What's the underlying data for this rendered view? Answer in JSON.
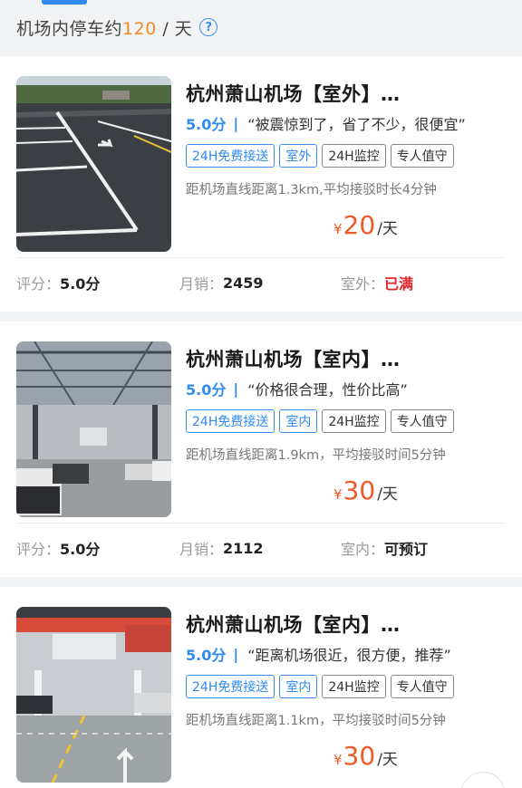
{
  "header": {
    "prefix": "机场内停车约",
    "count": "120",
    "suffix": " / 天",
    "help_icon": "question-circle-icon"
  },
  "colors": {
    "accent_blue": "#2f8bf0",
    "price_orange": "#f05a28",
    "full_red": "#e6252b"
  },
  "lots": [
    {
      "title": "杭州萧山机场【室外】…",
      "score": "5.0分",
      "separator": "|",
      "quote": "“被震惊到了，省了不少，很便宜”",
      "tags": [
        "24H免费接送",
        "室外",
        "24H监控",
        "专人值守"
      ],
      "distance": "距机场直线距离1.3km,平均接驳时长4分钟",
      "price_symbol": "¥",
      "price": "20",
      "price_unit": "/天",
      "rating_label": "评分：",
      "rating_value": "5.0分",
      "sales_label": "月销：",
      "sales_value": "2459",
      "status_label": "室外：",
      "status_value": "已满"
    },
    {
      "title": "杭州萧山机场【室内】…",
      "score": "5.0分",
      "separator": "|",
      "quote": "“价格很合理，性价比高”",
      "tags": [
        "24H免费接送",
        "室内",
        "24H监控",
        "专人值守"
      ],
      "distance": "距机场直线距离1.9km，平均接驳时间5分钟",
      "price_symbol": "¥",
      "price": "30",
      "price_unit": "/天",
      "rating_label": "评分：",
      "rating_value": "5.0分",
      "sales_label": "月销：",
      "sales_value": "2112",
      "status_label": "室内：",
      "status_value": "可预订"
    },
    {
      "title": "杭州萧山机场【室内】…",
      "score": "5.0分",
      "separator": "|",
      "quote": "“距离机场很近，很方便，推荐”",
      "tags": [
        "24H免费接送",
        "室内",
        "24H监控",
        "专人值守"
      ],
      "distance": "距机场直线距离1.1km，平均接驳时间5分钟",
      "price_symbol": "¥",
      "price": "30",
      "price_unit": "/天"
    }
  ]
}
